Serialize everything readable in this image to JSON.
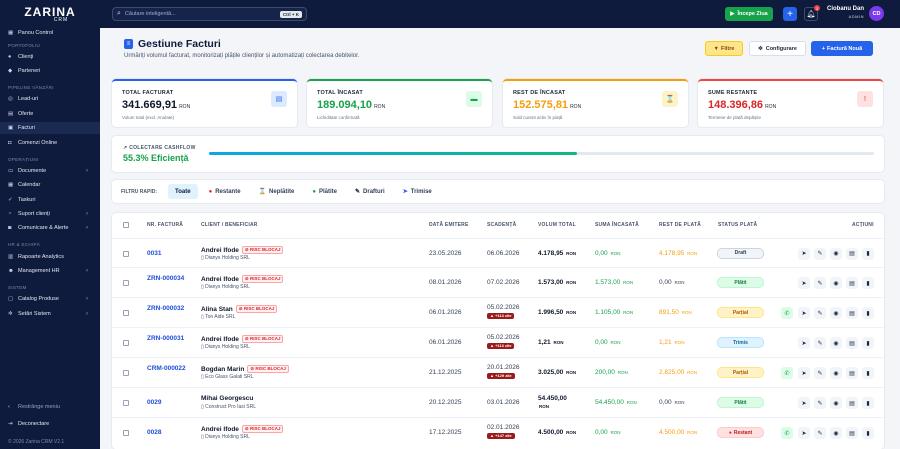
{
  "app": {
    "logo_main": "ZARINA",
    "logo_sub": "CRM"
  },
  "topbar": {
    "search_placeholder": "Căutare inteligentă...",
    "search_shortcut": "Ctrl + K",
    "start_day_label": "Începe Ziua",
    "notifications_count": "3",
    "user_name": "Ciobanu Dan",
    "user_role": "ADMIN",
    "user_initials": "CD"
  },
  "sidebar": {
    "items": [
      {
        "label": "Panou Control",
        "icon": "grid-icon"
      },
      {
        "section": "PORTOFOLIU"
      },
      {
        "label": "Clienți",
        "icon": "user-icon"
      },
      {
        "label": "Parteneri",
        "icon": "handshake-icon"
      },
      {
        "section": "PIPELINE VÂNZĂRI"
      },
      {
        "label": "Lead-uri",
        "icon": "target-icon"
      },
      {
        "label": "Oferte",
        "icon": "document-icon"
      },
      {
        "label": "Facturi",
        "icon": "invoice-icon",
        "active": true
      },
      {
        "label": "Comenzi Online",
        "icon": "cart-icon"
      },
      {
        "section": "OPERAȚIUNI"
      },
      {
        "label": "Documente",
        "icon": "folder-icon",
        "expandable": true
      },
      {
        "label": "Calendar",
        "icon": "calendar-icon"
      },
      {
        "label": "Taskuri",
        "icon": "check-icon"
      },
      {
        "label": "Suport clienți",
        "icon": "headset-icon",
        "expandable": true
      },
      {
        "label": "Comunicare & Alerte",
        "icon": "chat-icon",
        "expandable": true
      },
      {
        "section": "HR & ECHIPĂ"
      },
      {
        "label": "Rapoarte Analytics",
        "icon": "chart-icon"
      },
      {
        "label": "Management HR",
        "icon": "people-icon",
        "expandable": true
      },
      {
        "section": "SISTEM"
      },
      {
        "label": "Catalog Produse",
        "icon": "box-icon",
        "expandable": true
      },
      {
        "label": "Setări Sistem",
        "icon": "gear-icon",
        "expandable": true
      }
    ],
    "collapse_label": "Restrânge meniu",
    "logout_label": "Deconectare",
    "copyright": "© 2026 Zarina CRM V2.1"
  },
  "page": {
    "title": "Gestiune Facturi",
    "subtitle": "Urmăriți volumul facturat, monitorizați plățile clienților și automatizați colectarea debitelor.",
    "filter_label": "Filtre",
    "config_label": "Configurare",
    "new_invoice_label": "Factură Nouă"
  },
  "stats": [
    {
      "label": "TOTAL FACTURAT",
      "value": "341.669,91",
      "unit": "RON",
      "sub": "Volum total (excl. Anulate)",
      "color": "#0f172a",
      "border": "#2563eb",
      "icon": "document-icon",
      "icon_bg": "#dbeafe",
      "icon_fg": "#2563eb"
    },
    {
      "label": "TOTAL ÎNCASAT",
      "value": "189.094,10",
      "unit": "RON",
      "sub": "Lichiditate confirmată",
      "color": "#16a34a",
      "border": "#16a34a",
      "icon": "wallet-icon",
      "icon_bg": "#dcfce7",
      "icon_fg": "#16a34a"
    },
    {
      "label": "REST DE ÎNCASAT",
      "value": "152.575,81",
      "unit": "RON",
      "sub": "Sold curent activ în piață",
      "color": "#f59e0b",
      "border": "#f59e0b",
      "icon": "hourglass-icon",
      "icon_bg": "#fef3c7",
      "icon_fg": "#d97706"
    },
    {
      "label": "SUME RESTANTE",
      "value": "148.396,86",
      "unit": "RON",
      "sub": "Termene de plată depășite",
      "color": "#dc2626",
      "border": "#ef4444",
      "icon": "alert-icon",
      "icon_bg": "#fee2e2",
      "icon_fg": "#dc2626"
    }
  ],
  "cashflow": {
    "label": "COLECTARE CASHFLOW",
    "value": "55.3% Eficiență",
    "percent": 55.3
  },
  "quick_filter": {
    "label": "FILTRU RAPID:",
    "chips": [
      {
        "label": "Toate",
        "active": true,
        "icon": "",
        "color": ""
      },
      {
        "label": "Restante",
        "icon": "●",
        "color": "#dc2626"
      },
      {
        "label": "Neplătite",
        "icon": "⌛",
        "color": "#d97706"
      },
      {
        "label": "Plătite",
        "icon": "●",
        "color": "#16a34a"
      },
      {
        "label": "Drafturi",
        "icon": "✎",
        "color": "#1e293b"
      },
      {
        "label": "Trimise",
        "icon": "➤",
        "color": "#2563eb"
      }
    ]
  },
  "table": {
    "headers": [
      "NR. FACTURĂ",
      "CLIENT / BENEFICIAR",
      "DATĂ EMITERE",
      "SCADENȚĂ",
      "VOLUM TOTAL",
      "SUMA ÎNCASATĂ",
      "REST DE PLATĂ",
      "STATUS PLATĂ",
      "ACȚIUNI"
    ],
    "rows": [
      {
        "nr": "0031",
        "name": "Andrei Ifode",
        "risk": "RISC BLOCAJ",
        "company": "Dianys Holding SRL",
        "issued": "23.05.2026",
        "due": "06.06.2026",
        "late": "",
        "total": "4.178,95",
        "paid": "0,00",
        "rest": "4.178,95",
        "status": "Draft",
        "status_key": "draft",
        "whatsapp": false
      },
      {
        "nr": "ZRN-000034",
        "name": "Andrei Ifode",
        "risk": "RISC BLOCAJ",
        "company": "Dianys Holding SRL",
        "issued": "08.01.2026",
        "due": "07.02.2026",
        "late": "",
        "total": "1.573,00",
        "paid": "1.573,00",
        "rest": "0,00",
        "status": "Plătit",
        "status_key": "paid",
        "whatsapp": false
      },
      {
        "nr": "ZRN-000032",
        "name": "Alina Stan",
        "risk": "RISC BLOCAJ",
        "company": "Ton Aide SRL",
        "issued": "06.01.2026",
        "due": "05.02.2026",
        "late": "+113 zile",
        "total": "1.996,50",
        "paid": "1.105,00",
        "rest": "891,50",
        "status": "Parțial",
        "status_key": "partial",
        "whatsapp": true
      },
      {
        "nr": "ZRN-000031",
        "name": "Andrei Ifode",
        "risk": "RISC BLOCAJ",
        "company": "Dianys Holding SRL",
        "issued": "06.01.2026",
        "due": "05.02.2026",
        "late": "+113 zile",
        "total": "1,21",
        "paid": "0,00",
        "rest": "1,21",
        "status": "Trimis",
        "status_key": "sent",
        "whatsapp": false
      },
      {
        "nr": "CRM-000022",
        "name": "Bogdan Marin",
        "risk": "RISC BLOCAJ",
        "company": "Eco Glass Galati SRL",
        "issued": "21.12.2025",
        "due": "20.01.2026",
        "late": "+129 zile",
        "total": "3.025,00",
        "paid": "200,00",
        "rest": "2.825,00",
        "status": "Parțial",
        "status_key": "partial",
        "whatsapp": true
      },
      {
        "nr": "0029",
        "name": "Mihai Georgescu",
        "risk": "",
        "company": "Construct Pro Iasi SRL",
        "issued": "20.12.2025",
        "due": "03.01.2026",
        "late": "",
        "total": "54.450,00",
        "paid": "54.450,00",
        "rest": "0,00",
        "status": "Plătit",
        "status_key": "paid",
        "whatsapp": false
      },
      {
        "nr": "0028",
        "name": "Andrei Ifode",
        "risk": "RISC BLOCAJ",
        "company": "Dianys Holding SRL",
        "issued": "17.12.2025",
        "due": "02.01.2026",
        "late": "+147 zile",
        "total": "4.500,00",
        "paid": "0,00",
        "rest": "4.500,00",
        "status": "Restant",
        "status_key": "overdue",
        "whatsapp": true
      }
    ]
  },
  "currency": "RON"
}
